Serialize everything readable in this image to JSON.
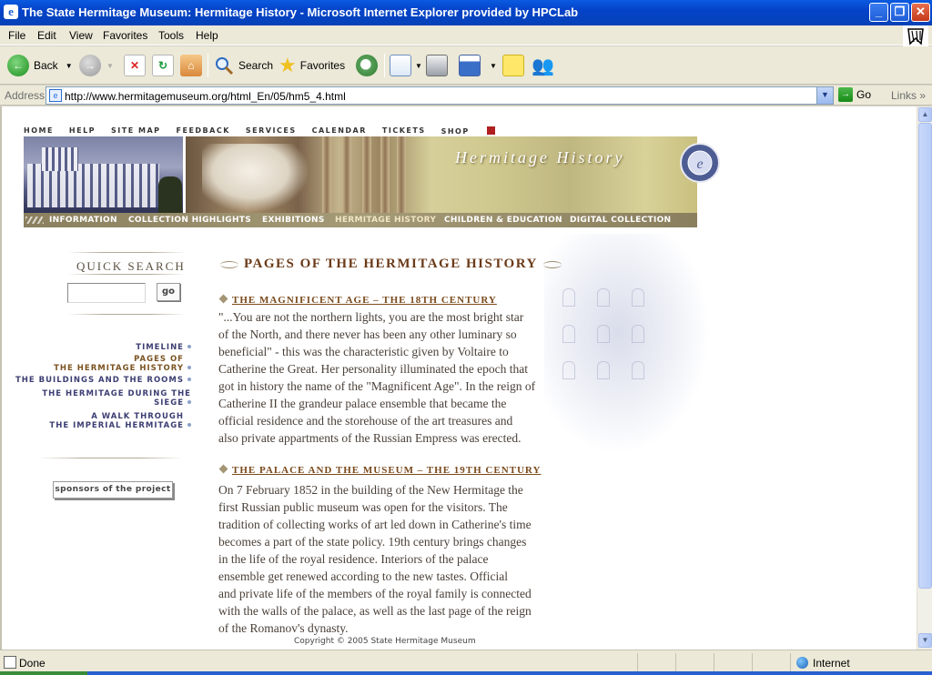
{
  "window": {
    "title": "The State Hermitage Museum: Hermitage History - Microsoft Internet Explorer provided by HPCLab"
  },
  "menu": [
    "File",
    "Edit",
    "View",
    "Favorites",
    "Tools",
    "Help"
  ],
  "toolbar": {
    "back": "Back",
    "search": "Search",
    "favorites": "Favorites"
  },
  "address": {
    "label": "Address",
    "url": "http://www.hermitagemuseum.org/html_En/05/hm5_4.html",
    "go": "Go",
    "links": "Links"
  },
  "status": {
    "text": "Done",
    "zone": "Internet"
  },
  "site": {
    "topnav": [
      "HOME",
      "HELP",
      "SITE MAP",
      "FEEDBACK",
      "SERVICES",
      "CALENDAR",
      "TICKETS",
      "SHOP"
    ],
    "banner_title": "Hermitage History",
    "sections": [
      "INFORMATION",
      "COLLECTION HIGHLIGHTS",
      "EXHIBITIONS",
      "HERMITAGE HISTORY",
      "CHILDREN & EDUCATION",
      "DIGITAL COLLECTION"
    ],
    "active_section": "HERMITAGE HISTORY",
    "quick_search": {
      "title": "QUICK SEARCH",
      "go": "go"
    },
    "leftnav": [
      [
        "TIMELINE"
      ],
      [
        "PAGES OF",
        "THE HERMITAGE HISTORY"
      ],
      [
        "THE BUILDINGS AND THE ROOMS"
      ],
      [
        "THE HERMITAGE DURING THE SIEGE"
      ],
      [
        "A WALK THROUGH",
        "THE IMPERIAL HERMITAGE"
      ]
    ],
    "sponsors": "sponsors of the project",
    "page_title": "PAGES OF THE HERMITAGE HISTORY",
    "articles": [
      {
        "heading": "THE MAGNIFICENT AGE – THE 18TH CENTURY",
        "lines": [
          "\"...You are not the northern lights, you are the most bright star",
          "of the North, and there never has been any other luminary so",
          "beneficial\" - this was the characteristic given by Voltaire to",
          "Catherine the Great. Her personality illuminated the epoch that",
          "got in history the name of the \"Magnificent Age\". In the reign of",
          "Catherine II the grandeur palace ensemble that became the",
          "official residence and the storehouse of the art treasures and",
          "also private appartments of the Russian Empress was erected."
        ]
      },
      {
        "heading": "THE PALACE AND THE MUSEUM – THE 19TH CENTURY",
        "lines": [
          "On 7 February 1852 in the building of the New Hermitage the",
          "first Russian public museum was open for the visitors. The",
          "tradition of collecting works of art led down in Catherine's time",
          "becomes a part of the state policy. 19th century brings changes",
          "in the life of the royal residence. Interiors of the palace",
          "ensemble get renewed according to the new tastes. Official",
          "and private life of the members of the royal family is connected",
          "with the walls of the palace, as well as the last page of the reign",
          "of the Romanov's dynasty."
        ]
      }
    ],
    "copyright": "Copyright © 2005 State Hermitage Museum"
  }
}
